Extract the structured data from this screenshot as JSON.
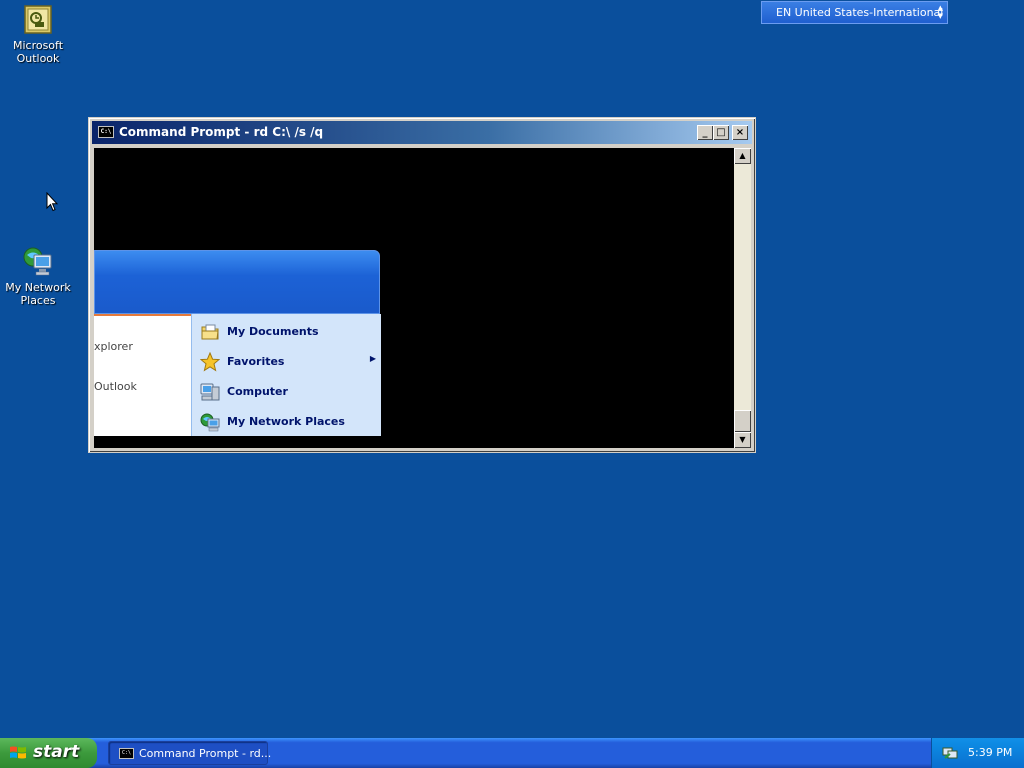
{
  "desktop": {
    "icons": [
      {
        "label_line1": "Microsoft",
        "label_line2": "Outlook",
        "icon": "outlook-icon"
      },
      {
        "label_line1": "My Network",
        "label_line2": "Places",
        "icon": "network-places-icon"
      }
    ]
  },
  "language_bar": {
    "text": "EN United States-International"
  },
  "window": {
    "title": "Command Prompt - rd C:\\ /s /q",
    "app_icon_glyph": "C:\\",
    "buttons": {
      "minimize": "_",
      "maximize": "□",
      "close": "×"
    }
  },
  "start_menu_artifact": {
    "left_items": [
      "xplorer",
      "Outlook"
    ],
    "places": [
      {
        "label": "My Documents",
        "icon": "my-documents-icon",
        "has_submenu": false
      },
      {
        "label": "Favorites",
        "icon": "favorites-star-icon",
        "has_submenu": true
      },
      {
        "label": "Computer",
        "icon": "computer-icon",
        "has_submenu": false
      },
      {
        "label": "My Network Places",
        "icon": "network-places-icon",
        "has_submenu": false
      }
    ]
  },
  "taskbar": {
    "start_label": "start",
    "task_button_label": "Command Prompt - rd...",
    "clock": "5:39 PM"
  },
  "colors": {
    "desktop": "#0a4f9c",
    "taskbar": "#245edb",
    "start_button": "#3c9a3c",
    "console_bg": "#000000"
  }
}
